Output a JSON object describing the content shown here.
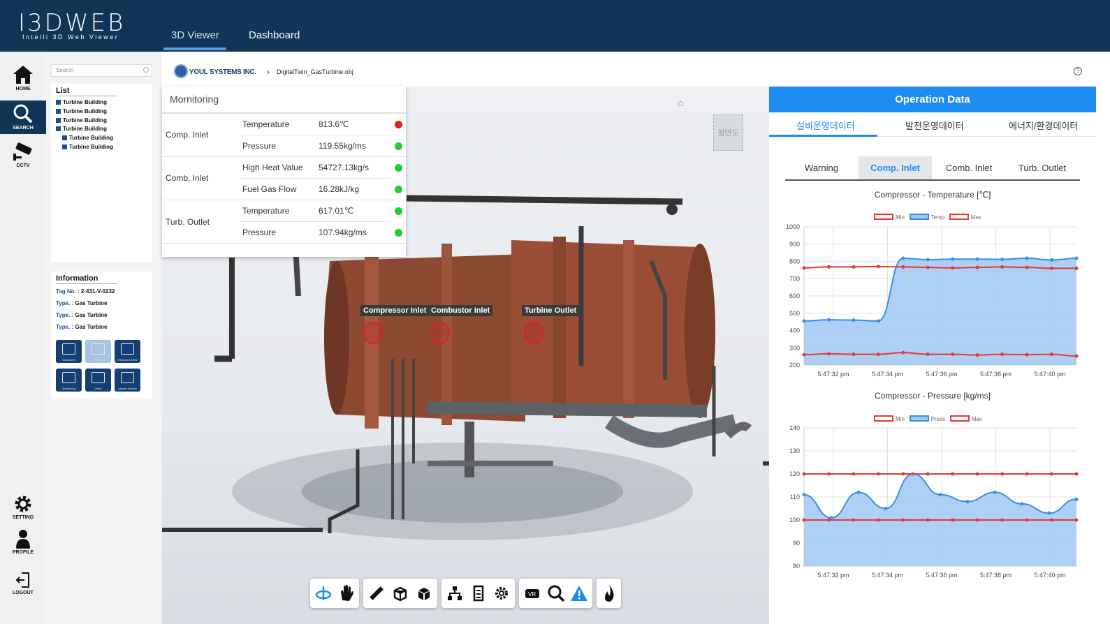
{
  "app": {
    "logo_big": "I3DWEB",
    "logo_small": "Intelli 3D Web Viewer"
  },
  "nav": {
    "tabs": [
      {
        "label": "3D Viewer",
        "active": true
      },
      {
        "label": "Dashboard",
        "active": false
      }
    ]
  },
  "rail": {
    "home": "HOME",
    "search": "SEARCH",
    "cctv": "CCTV",
    "setting": "SETTING",
    "profile": "PROFILE",
    "logout": "LOGOUT"
  },
  "sidebar": {
    "search_placeholder": "Search",
    "list_title": "List",
    "list_items": [
      "Turbine Building",
      "Turbine Building",
      "Turbine Building",
      "Turbine Building",
      "Turbine Building",
      "Turbine Building"
    ],
    "info_title": "Information",
    "info": {
      "tag_key": "Tag No. :",
      "tag_val": "2-431-V-0232",
      "type_key": "Type. :",
      "type_val": "Gas Turbine"
    },
    "tools": [
      "Document",
      "P&ID",
      "Panorama View",
      "Monitoring",
      "Video",
      "Legacy System"
    ]
  },
  "breadcrumb": {
    "company": "YOUL SYSTEMS INC.",
    "file": "DigitalTwin_GasTurbine.obj"
  },
  "viewport": {
    "view_cube_label": "정면도",
    "hotspots": [
      "Compressor Inlet",
      "Combustor Inlet",
      "Turbine Outlet"
    ]
  },
  "monitoring": {
    "title": "Mornitoring",
    "groups": [
      {
        "name": "Comp. Inlet",
        "rows": [
          {
            "label": "Temperature",
            "value": "813.6℃",
            "status": "#e02020"
          },
          {
            "label": "Pressure",
            "value": "119.55kg/ms",
            "status": "#22cc33"
          }
        ]
      },
      {
        "name": "Comb. Inlet",
        "rows": [
          {
            "label": "High Heat Value",
            "value": "54727.13kg/s",
            "status": "#22cc33"
          },
          {
            "label": "Fuel Gas Flow",
            "value": "16.28kJ/kg",
            "status": "#22cc33"
          }
        ]
      },
      {
        "name": "Turb. Outlet",
        "rows": [
          {
            "label": "Temperature",
            "value": "617.01℃",
            "status": "#22cc33"
          },
          {
            "label": "Pressure",
            "value": "107.94kg/ms",
            "status": "#22cc33"
          }
        ]
      }
    ]
  },
  "toolbar_icons": [
    "rotate-icon",
    "pan-hand-icon",
    "measure-icon",
    "section-box-icon",
    "cube-icon",
    "hierarchy-icon",
    "properties-icon",
    "settings-icon",
    "vr-icon",
    "zoom-icon",
    "warning-icon",
    "fire-icon"
  ],
  "operation": {
    "title": "Operation Data",
    "tabs": [
      "설비운영데이터",
      "발전운영데이터",
      "에너지/환경데이터"
    ],
    "subtabs": [
      "Warning",
      "Comp. Inlet",
      "Comb. Inlet",
      "Turb. Outlet"
    ]
  },
  "chart_data": [
    {
      "type": "area",
      "title": "Compressor - Temperature [℃]",
      "x": [
        "5:47:32 pm",
        "5:47:34 pm",
        "5:47:36 pm",
        "5:47:38 pm",
        "5:47:40 pm"
      ],
      "legend": [
        "Min",
        "Temp",
        "Max"
      ],
      "ylim": [
        200,
        1000
      ],
      "yticks": [
        200,
        300,
        400,
        500,
        600,
        700,
        800,
        900,
        1000
      ],
      "series": [
        {
          "name": "Min",
          "color": "#e53935",
          "values": [
            260,
            265,
            262,
            262,
            272,
            262,
            262,
            258,
            262,
            260,
            262,
            252
          ]
        },
        {
          "name": "Temp",
          "color": "#3a8ee6",
          "values": [
            455,
            462,
            460,
            455,
            818,
            810,
            813,
            813,
            812,
            818,
            808,
            818
          ]
        },
        {
          "name": "Max",
          "color": "#e53935",
          "values": [
            762,
            768,
            768,
            770,
            768,
            765,
            762,
            765,
            768,
            765,
            760,
            760
          ]
        }
      ]
    },
    {
      "type": "area",
      "title": "Compressor - Pressure [kg/ms]",
      "x": [
        "5:47:32 pm",
        "5:47:34 pm",
        "5:47:36 pm",
        "5:47:38 pm",
        "5:47:40 pm"
      ],
      "legend": [
        "Min",
        "Press",
        "Max"
      ],
      "ylim": [
        80,
        140
      ],
      "yticks": [
        80,
        90,
        100,
        110,
        120,
        130,
        140
      ],
      "series": [
        {
          "name": "Min",
          "color": "#e53935",
          "values": [
            100,
            100,
            100,
            100,
            100,
            100,
            100,
            100,
            100,
            100,
            100,
            100
          ]
        },
        {
          "name": "Press",
          "color": "#3a8ee6",
          "values": [
            111,
            101,
            112,
            105,
            120,
            111,
            108,
            112,
            107,
            103,
            109
          ]
        },
        {
          "name": "Max",
          "color": "#e53935",
          "values": [
            120,
            120,
            120,
            120,
            120,
            120,
            120,
            120,
            120,
            120,
            120,
            120
          ]
        }
      ]
    }
  ]
}
